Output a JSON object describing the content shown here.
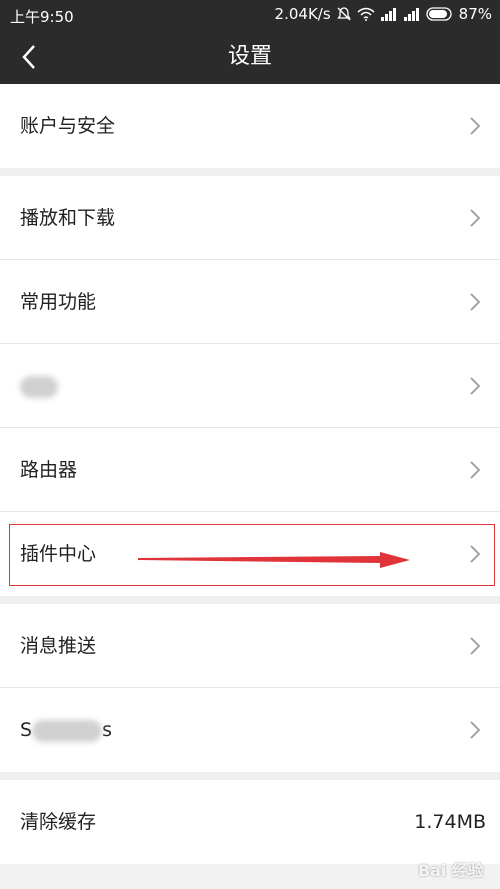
{
  "status_bar": {
    "time": "上午9:50",
    "speed": "2.04K/s",
    "battery": "87%"
  },
  "header": {
    "title": "设置"
  },
  "groups": [
    {
      "items": [
        {
          "label": "账户与安全"
        }
      ]
    },
    {
      "items": [
        {
          "label": "播放和下载"
        },
        {
          "label": "常用功能"
        },
        {
          "label": "",
          "redacted": true
        },
        {
          "label": "路由器"
        },
        {
          "label": "插件中心",
          "highlighted": true
        }
      ]
    },
    {
      "items": [
        {
          "label": "消息推送"
        },
        {
          "label": "S",
          "label_suffix": "s",
          "redacted": true
        }
      ]
    },
    {
      "items": [
        {
          "label": "清除缓存",
          "value": "1.74MB"
        }
      ]
    }
  ],
  "annotation": {
    "highlight_color": "#e0343a"
  },
  "watermark": "Bai 经验"
}
